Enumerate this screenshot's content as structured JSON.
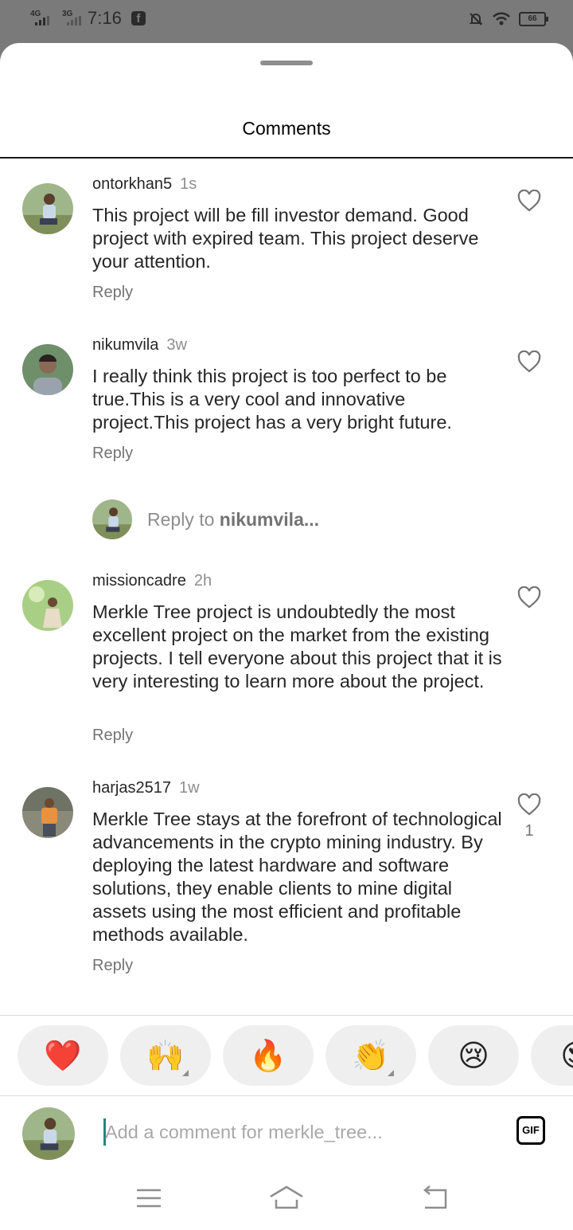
{
  "status_bar": {
    "signal1": "4G",
    "signal2": "3G",
    "time": "7:16",
    "battery": "66"
  },
  "sheet": {
    "title": "Comments"
  },
  "comments": [
    {
      "username": "ontorkhan5",
      "time": "1s",
      "text": "This project will be fill investor demand. Good project with expired team. This project deserve your attention.",
      "reply_label": "Reply"
    },
    {
      "username": "nikumvila",
      "time": "3w",
      "text": "I really think this project is too perfect to be true.This is a very cool and innovative project.This project has a very bright future.",
      "reply_label": "Reply"
    },
    {
      "username": "missioncadre",
      "time": "2h",
      "text": "Merkle Tree project is undoubtedly the most excellent project on the market from the existing projects. I tell everyone about this project that it is very interesting to learn more about the project.",
      "reply_label": "Reply"
    },
    {
      "username": "harjas2517",
      "time": "1w",
      "text": "Merkle Tree stays at the forefront of technological advancements in the crypto mining industry. By deploying the latest hardware and software solutions, they enable clients to mine digital assets using the most efficient and profitable methods available.",
      "reply_label": "Reply",
      "likes": "1"
    }
  ],
  "reply_to": {
    "prefix": "Reply to ",
    "user": "nikumvila..."
  },
  "emoji_bar": [
    {
      "emoji": "❤️",
      "name": "red-heart"
    },
    {
      "emoji": "🙌",
      "name": "raising-hands"
    },
    {
      "emoji": "🔥",
      "name": "fire"
    },
    {
      "emoji": "👏",
      "name": "clapping-hands"
    },
    {
      "emoji": "😢",
      "name": "crying-face"
    },
    {
      "emoji": "😍",
      "name": "heart-eyes"
    }
  ],
  "input": {
    "placeholder": "Add a comment for merkle_tree...",
    "gif_label": "GIF"
  },
  "colors": {
    "background_dim": "#7a7a7a",
    "text_primary": "#262626",
    "text_secondary": "#8e8e8e",
    "chip_bg": "#efefef"
  }
}
